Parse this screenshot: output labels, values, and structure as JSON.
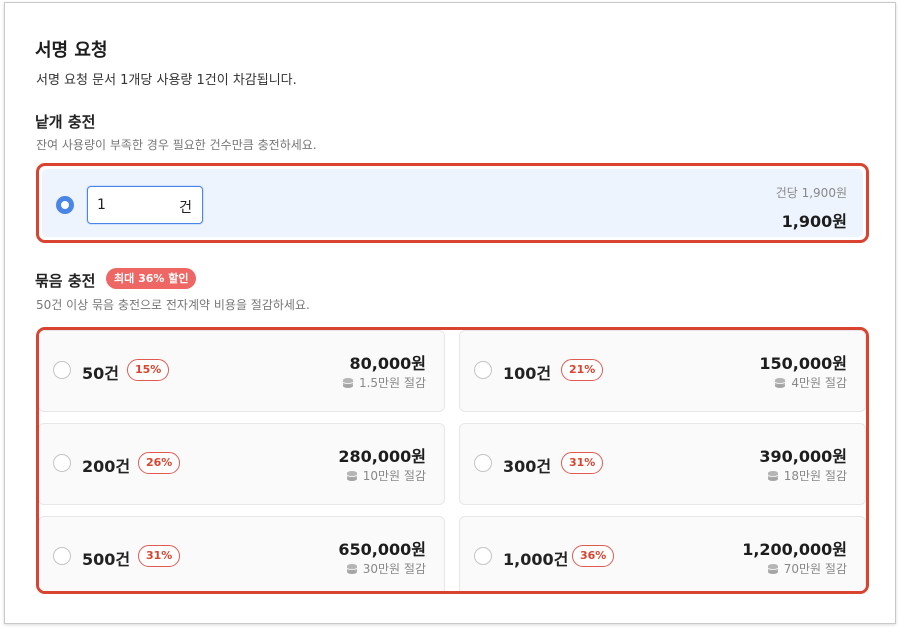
{
  "header": {
    "title": "서명 요청",
    "description": "서명 요청 문서 1개당 사용량 1건이 차감됩니다."
  },
  "single": {
    "title": "낱개 충전",
    "description": "잔여 사용량이 부족한 경우 필요한 건수만큼 충전하세요.",
    "quantity": "1",
    "unit": "건",
    "unit_price": "건당 1,900원",
    "total": "1,900원",
    "selected": true,
    "accent": "#4a86e8"
  },
  "bundle": {
    "title": "묶음 충전",
    "badge": "최대 36% 할인",
    "description": "50건 이상 묶음 충전으로 전자계약 비용을 절감하세요.",
    "highlight_color": "#d9432f",
    "options": [
      {
        "count": "50건",
        "discount": "15%",
        "price": "80,000원",
        "saving": "1.5만원 절감"
      },
      {
        "count": "100건",
        "discount": "21%",
        "price": "150,000원",
        "saving": "4만원 절감"
      },
      {
        "count": "200건",
        "discount": "26%",
        "price": "280,000원",
        "saving": "10만원 절감"
      },
      {
        "count": "300건",
        "discount": "31%",
        "price": "390,000원",
        "saving": "18만원 절감"
      },
      {
        "count": "500건",
        "discount": "31%",
        "price": "650,000원",
        "saving": "30만원 절감"
      },
      {
        "count": "1,000건",
        "discount": "36%",
        "price": "1,200,000원",
        "saving": "70만원 절감"
      }
    ]
  }
}
